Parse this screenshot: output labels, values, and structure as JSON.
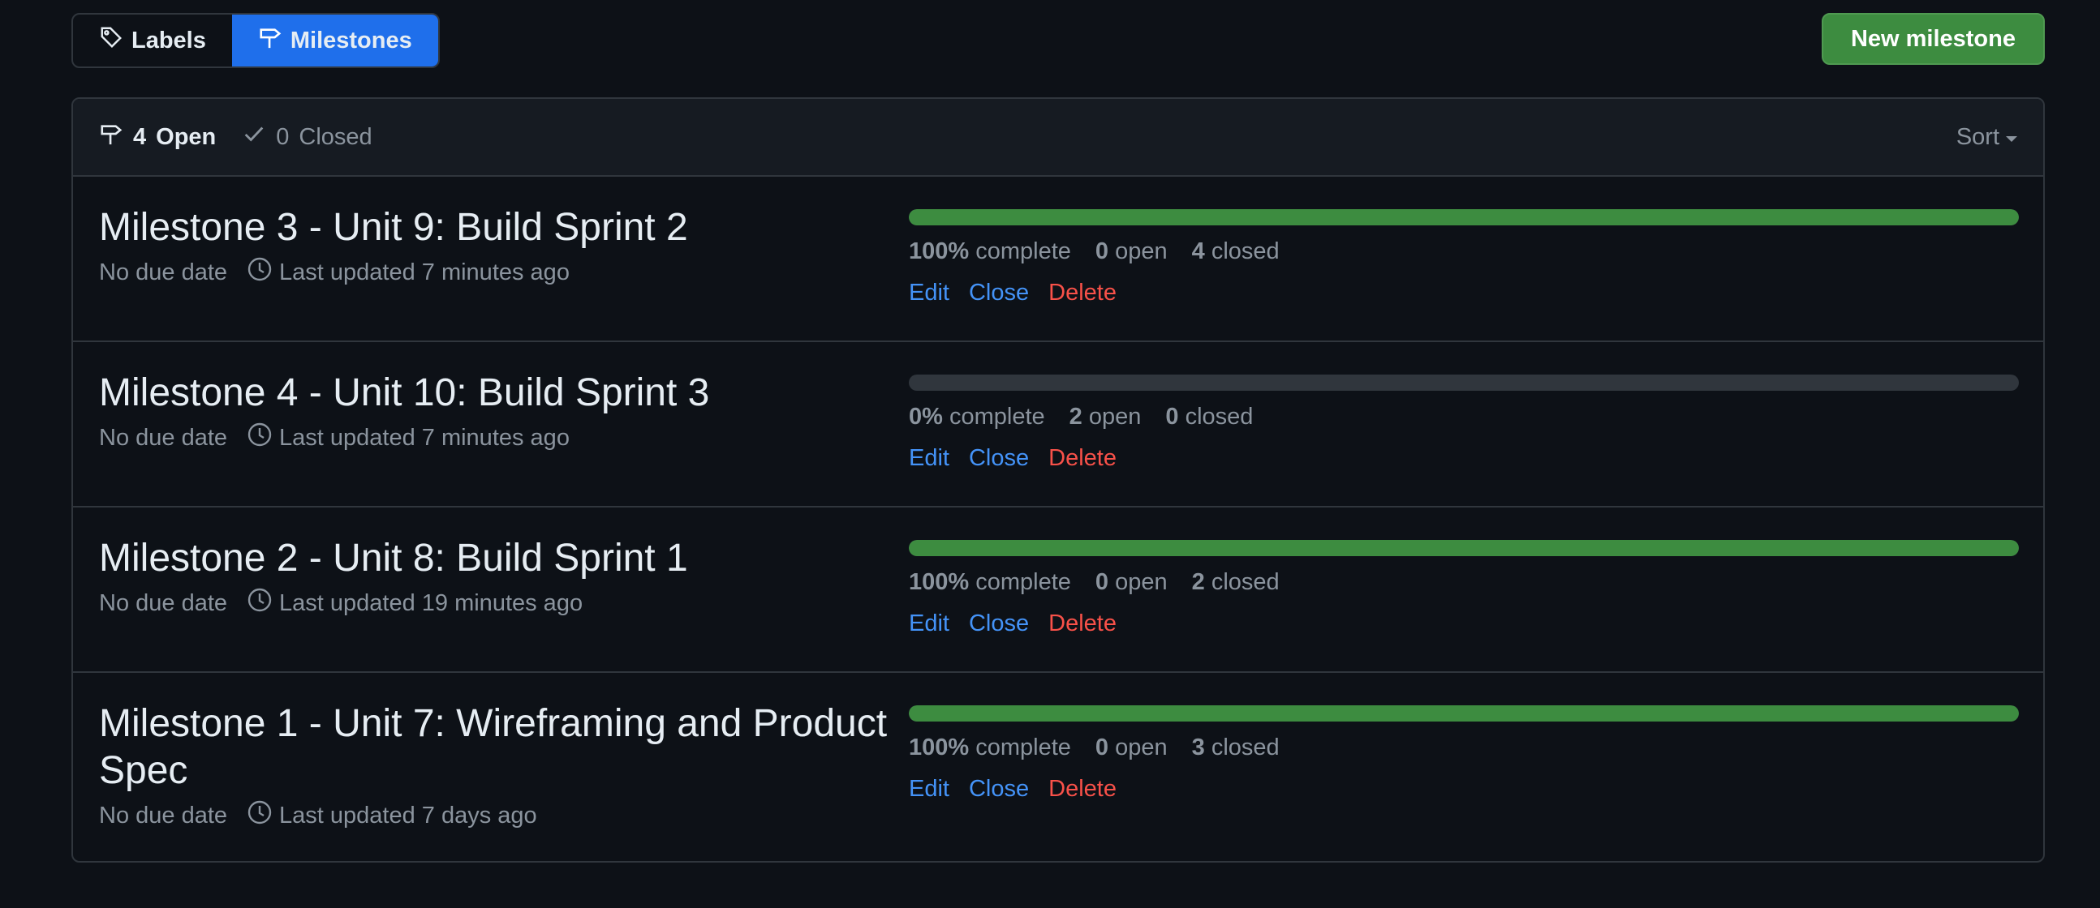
{
  "tabs": {
    "labels": "Labels",
    "milestones": "Milestones"
  },
  "new_milestone_label": "New milestone",
  "header": {
    "open_count": "4",
    "open_label": "Open",
    "closed_count": "0",
    "closed_label": "Closed",
    "sort_label": "Sort"
  },
  "colors": {
    "accent": "#1f6feb",
    "success": "#3d8c40",
    "link": "#4493f8",
    "danger": "#f85149"
  },
  "milestones": [
    {
      "title": "Milestone 3 - Unit 9: Build Sprint 2",
      "due": "No due date",
      "updated": "Last updated 7 minutes ago",
      "progress": 1.0,
      "percent": "100%",
      "complete_label": "complete",
      "open": "0",
      "open_label": "open",
      "closed": "4",
      "closed_label": "closed",
      "edit": "Edit",
      "close": "Close",
      "delete": "Delete"
    },
    {
      "title": "Milestone 4 - Unit 10: Build Sprint 3",
      "due": "No due date",
      "updated": "Last updated 7 minutes ago",
      "progress": 0.0,
      "percent": "0%",
      "complete_label": "complete",
      "open": "2",
      "open_label": "open",
      "closed": "0",
      "closed_label": "closed",
      "edit": "Edit",
      "close": "Close",
      "delete": "Delete"
    },
    {
      "title": "Milestone 2 - Unit 8: Build Sprint 1",
      "due": "No due date",
      "updated": "Last updated 19 minutes ago",
      "progress": 1.0,
      "percent": "100%",
      "complete_label": "complete",
      "open": "0",
      "open_label": "open",
      "closed": "2",
      "closed_label": "closed",
      "edit": "Edit",
      "close": "Close",
      "delete": "Delete"
    },
    {
      "title": "Milestone 1 - Unit 7: Wireframing and Product Spec",
      "due": "No due date",
      "updated": "Last updated 7 days ago",
      "progress": 1.0,
      "percent": "100%",
      "complete_label": "complete",
      "open": "0",
      "open_label": "open",
      "closed": "3",
      "closed_label": "closed",
      "edit": "Edit",
      "close": "Close",
      "delete": "Delete"
    }
  ]
}
